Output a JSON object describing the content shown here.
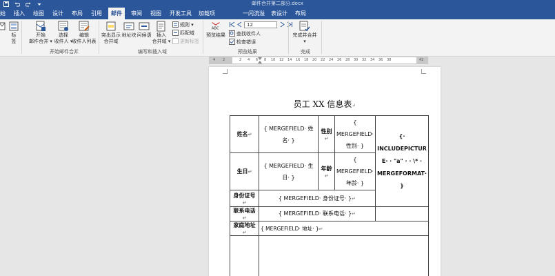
{
  "title_bar": {
    "doc_title": "邮件合并第二部分.docx",
    "qat": [
      "save-icon",
      "undo-icon",
      "redo-icon",
      "customize-icon"
    ]
  },
  "tabs": [
    {
      "label": "始"
    },
    {
      "label": "插入"
    },
    {
      "label": "绘图"
    },
    {
      "label": "设计"
    },
    {
      "label": "布局"
    },
    {
      "label": "引用"
    },
    {
      "label": "邮件",
      "active": true
    },
    {
      "label": "审阅"
    },
    {
      "label": "视图"
    },
    {
      "label": "开发工具"
    },
    {
      "label": "加载项"
    },
    {
      "label": "一闪流溢"
    },
    {
      "label": "表设计"
    },
    {
      "label": "布局"
    }
  ],
  "ribbon": {
    "start_group": {
      "label": "开始邮件合并",
      "buttons": [
        {
          "line1": "开始",
          "line2": "邮件合并 ▾"
        },
        {
          "line1": "选择",
          "line2": "收件人 ▾"
        },
        {
          "line1": "编辑",
          "line2": "收件人列表"
        }
      ]
    },
    "partial_left": [
      {
        "line1": "标",
        "line2": "签"
      }
    ],
    "write_group": {
      "label": "编写和插入域",
      "buttons": [
        {
          "line1": "突出显示",
          "line2": "合并域"
        },
        {
          "line1": "地址块",
          "line2": ""
        },
        {
          "line1": "问候语",
          "line2": ""
        },
        {
          "line1": "插入",
          "line2": "合并域 ▾"
        }
      ],
      "small": [
        {
          "label": "规则 ▾",
          "disabled": false
        },
        {
          "label": "匹配域",
          "disabled": false
        },
        {
          "label": "更新标签",
          "disabled": true
        }
      ]
    },
    "preview_group": {
      "label": "预览结果",
      "button": {
        "line1": "预览结果",
        "icon_text": "ABC"
      },
      "record": "12",
      "small": [
        {
          "label": "查找收件人"
        },
        {
          "label": "检查错误"
        }
      ]
    },
    "finish_group": {
      "label": "完成",
      "button": {
        "line1": "完成并合并",
        "line2": "▾"
      }
    }
  },
  "ruler": {
    "ticks": [
      "4",
      "2",
      "",
      "2",
      "4",
      "6",
      "8",
      "10",
      "12",
      "14",
      "16",
      "18",
      "20",
      "22",
      "24",
      "26",
      "28",
      "30",
      "32",
      "34",
      "36",
      "38",
      "",
      "42"
    ]
  },
  "document": {
    "heading": "员工 XX 信息表",
    "para_mark": "↵",
    "rows": {
      "name": {
        "label": "姓名",
        "field_line1": "{ MERGEFIELD· 姓",
        "field_line2": "名· }"
      },
      "gender": {
        "label": "性别",
        "field_line1": "{",
        "field_line2": "MERGEFIELD·",
        "field_line3": "性别· }"
      },
      "birth": {
        "label": "生日",
        "field_line1": "{ MERGEFIELD· 生",
        "field_line2": "日· }"
      },
      "age": {
        "label": "年龄",
        "field_line1": "{",
        "field_line2": "MERGEFIELD·",
        "field_line3": "年龄· }"
      },
      "photo": {
        "line1": "{·",
        "line2": "INCLUDEPICTUR",
        "line3": "E· · \"a\" · · \\* ·",
        "line4": "MERGEFORMAT·",
        "line5": "}"
      },
      "idcard": {
        "label": "身份证号",
        "field": "{ MERGEFIELD· 身份证号· }"
      },
      "phone": {
        "label": "联系电话",
        "field": "{ MERGEFIELD· 联系电话· }"
      },
      "address": {
        "label": "家庭地址",
        "field": "{ MERGEFIELD· 地址· }"
      }
    }
  },
  "colors": {
    "accent": "#2b579a",
    "ribbon_bg": "#f3f3f3",
    "workspace": "#e6e6e6"
  }
}
